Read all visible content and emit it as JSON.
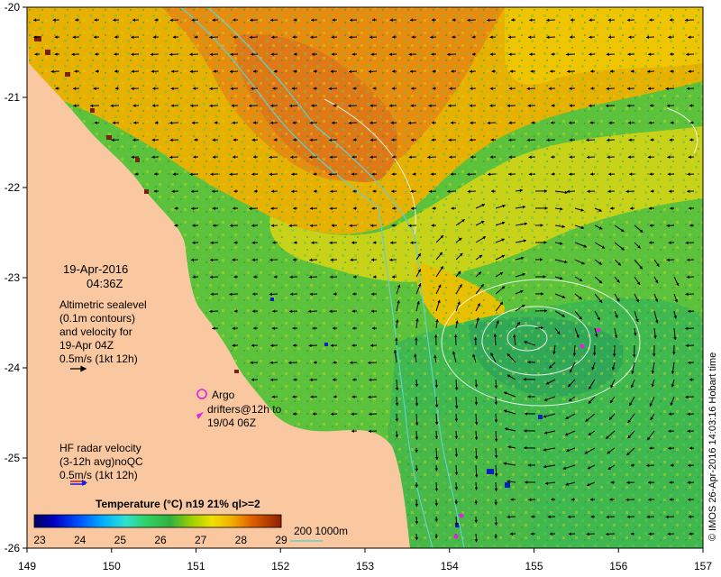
{
  "date": "19-Apr-2016",
  "time": "04:36Z",
  "altimetry": {
    "lines": [
      "Altimetric sealevel",
      "(0.1m contours)",
      "and velocity for",
      "19-Apr 04Z"
    ],
    "scale": "0.5m/s (1kt 12h)"
  },
  "argo": {
    "label": "Argo",
    "drifters_lines": [
      "drifters@12h to",
      "19/04 06Z"
    ]
  },
  "hf_radar": {
    "lines": [
      "HF radar velocity",
      "(3-12h avg)noQC"
    ],
    "scale": "0.5m/s (1kt 12h)"
  },
  "colorbar": {
    "title": "Temperature (°C) n19 21% ql>=2",
    "ticks": [
      "23",
      "24",
      "25",
      "26",
      "27",
      "28",
      "29"
    ],
    "colors": [
      "#000080",
      "#0000dd",
      "#1060ff",
      "#00b0ff",
      "#20e0e0",
      "#40e880",
      "#20b040",
      "#90d000",
      "#f0e800",
      "#f0b000",
      "#e87000",
      "#c03000",
      "#902000"
    ]
  },
  "bathymetry": {
    "label": "200  1000m"
  },
  "credit": "© IMOS 26-Apr-2016 14:03:16 Hobart time",
  "axes": {
    "lon_ticks": [
      "149",
      "150",
      "151",
      "152",
      "153",
      "154",
      "155",
      "156",
      "157"
    ],
    "lat_ticks": [
      "-20",
      "-21",
      "-22",
      "-23",
      "-24",
      "-25",
      "-26"
    ]
  },
  "colors": {
    "land": "#f9c8a0",
    "bathy": "#60d0d0",
    "contour": "#ffffff",
    "argo": "#e020e0"
  }
}
